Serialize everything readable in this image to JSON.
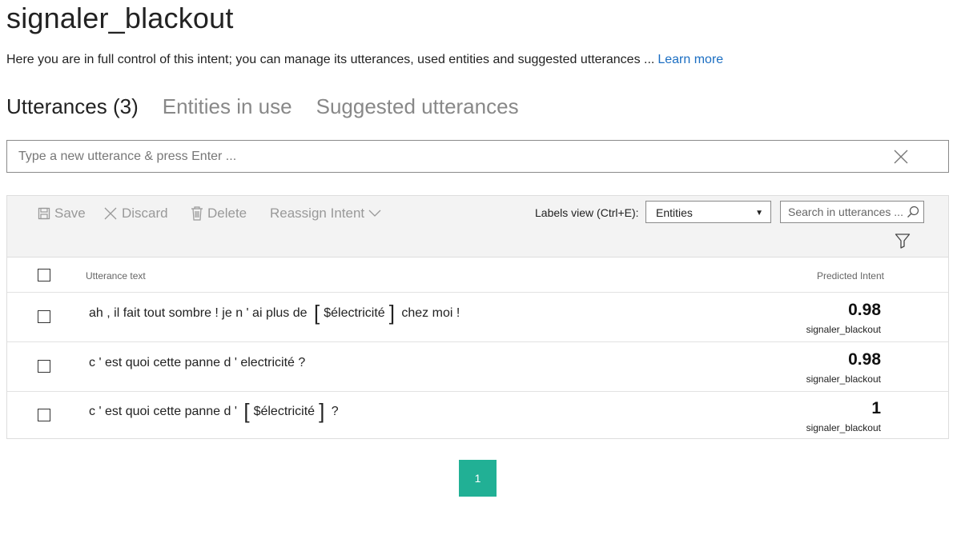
{
  "page": {
    "title": "signaler_blackout",
    "description": "Here you are in full control of this intent; you can manage its utterances, used entities and suggested utterances ...",
    "learn_more": "Learn more"
  },
  "tabs": [
    {
      "label": "Utterances (3)",
      "active": true
    },
    {
      "label": "Entities in use",
      "active": false
    },
    {
      "label": "Suggested utterances",
      "active": false
    }
  ],
  "new_utterance": {
    "placeholder": "Type a new utterance & press Enter ...",
    "clear_icon": "close-icon"
  },
  "toolbar": {
    "save_label": "Save",
    "discard_label": "Discard",
    "delete_label": "Delete",
    "reassign_label": "Reassign Intent",
    "labels_view_label": "Labels view (Ctrl+E):",
    "labels_view_value": "Entities",
    "search_placeholder": "Search in utterances ..."
  },
  "columns": {
    "utterance": "Utterance text",
    "intent": "Predicted Intent"
  },
  "rows": [
    {
      "before": "ah , il fait tout sombre ! je n ' ai plus de ",
      "entity": "$électricité",
      "after": " chez moi !",
      "score": "0.98",
      "intent": "signaler_blackout"
    },
    {
      "before": "c ' est quoi cette panne d ' electricité ?",
      "entity": "",
      "after": "",
      "score": "0.98",
      "intent": "signaler_blackout"
    },
    {
      "before": "c ' est quoi cette panne d ' ",
      "entity": "$électricité",
      "after": " ?",
      "score": "1",
      "intent": "signaler_blackout"
    }
  ],
  "pagination": {
    "current": "1"
  },
  "colors": {
    "accent": "#21b095",
    "link": "#1b6ec2"
  }
}
